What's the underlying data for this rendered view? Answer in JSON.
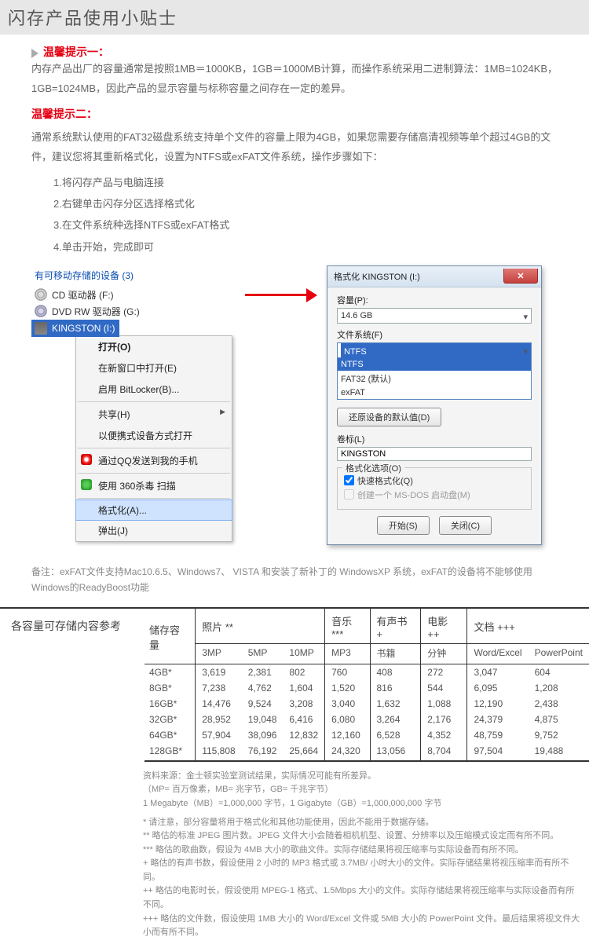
{
  "page": {
    "title": "闪存产品使用小贴士"
  },
  "tip1": {
    "heading": "温馨提示一：",
    "body": "内存产品出厂的容量通常是按照1MB＝1000KB，1GB＝1000MB计算，而操作系统采用二进制算法：1MB=1024KB，1GB=1024MB，因此产品的显示容量与标称容量之间存在一定的差异。"
  },
  "tip2": {
    "heading": "温馨提示二：",
    "body": "通常系统默认使用的FAT32磁盘系统支持单个文件的容量上限为4GB，如果您需要存储高清视频等单个超过4GB的文件，建议您将其重新格式化，设置为NTFS或exFAT文件系统，操作步骤如下：",
    "steps": [
      "1.将闪存产品与电脑连接",
      "2.右键单击闪存分区选择格式化",
      "3.在文件系统种选择NTFS或exFAT格式",
      "4.单击开始，完成即可"
    ]
  },
  "explorer": {
    "heading": "有可移动存储的设备 (3)",
    "cd": "CD 驱动器 (F:)",
    "dvd": "DVD RW 驱动器 (G:)",
    "usb": "KINGSTON (I:)"
  },
  "ctx": {
    "open": "打开(O)",
    "newwin": "在新窗口中打开(E)",
    "bitlocker": "启用 BitLocker(B)...",
    "share": "共享(H)",
    "portable": "以便携式设备方式打开",
    "qq": "通过QQ发送到我的手机",
    "av": "使用 360杀毒 扫描",
    "format": "格式化(A)...",
    "eject": "弹出(J)"
  },
  "dlg": {
    "title": "格式化 KINGSTON (I:)",
    "close": "✕",
    "cap_label": "容量(P):",
    "cap_val": "14.6 GB",
    "fs_label": "文件系统(F)",
    "fs_val": "NTFS",
    "fs_opt1": "NTFS",
    "fs_opt2": "FAT32 (默认)",
    "fs_opt3": "exFAT",
    "restore": "还原设备的默认值(D)",
    "vol_label": "卷标(L)",
    "vol_val": "KINGSTON",
    "opt_legend": "格式化选项(O)",
    "quick": "快速格式化(Q)",
    "msdos": "创建一个 MS-DOS 启动盘(M)",
    "start": "开始(S)",
    "closebtn": "关闭(C)"
  },
  "note": "备注：exFAT文件支持Mac10.6.5、Windows7、 VISTA  和安装了新补丁的 WindowsXP 系统，exFAT的设备将不能够使用Windows的ReadyBoost功能",
  "table": {
    "label": "各容量可存储内容参考",
    "groups": {
      "cap": "储存容量",
      "photo": "照片 **",
      "music": "音乐***",
      "book": "有声书 +",
      "movie": "电影 ++",
      "doc": "文档 +++"
    },
    "subs": {
      "p1": "3MP",
      "p2": "5MP",
      "p3": "10MP",
      "m": "MP3",
      "b": "书籍",
      "mv": "分钟",
      "d1": "Word/Excel",
      "d2": "PowerPoint"
    },
    "rows": [
      {
        "cap": "4GB*",
        "v": [
          "3,619",
          "2,381",
          "802",
          "760",
          "408",
          "272",
          "3,047",
          "604"
        ]
      },
      {
        "cap": "8GB*",
        "v": [
          "7,238",
          "4,762",
          "1,604",
          "1,520",
          "816",
          "544",
          "6,095",
          "1,208"
        ]
      },
      {
        "cap": "16GB*",
        "v": [
          "14,476",
          "9,524",
          "3,208",
          "3,040",
          "1,632",
          "1,088",
          "12,190",
          "2,438"
        ]
      },
      {
        "cap": "32GB*",
        "v": [
          "28,952",
          "19,048",
          "6,416",
          "6,080",
          "3,264",
          "2,176",
          "24,379",
          "4,875"
        ]
      },
      {
        "cap": "64GB*",
        "v": [
          "57,904",
          "38,096",
          "12,832",
          "12,160",
          "6,528",
          "4,352",
          "48,759",
          "9,752"
        ]
      },
      {
        "cap": "128GB*",
        "v": [
          "115,808",
          "76,192",
          "25,664",
          "24,320",
          "13,056",
          "8,704",
          "97,504",
          "19,488"
        ]
      }
    ]
  },
  "fine": {
    "l1": "资料来源：金士顿实验室测试结果，实际情况可能有所差异。",
    "l2": "（MP= 百万像素，MB= 兆字节，GB= 千兆字节）",
    "l3": "1 Megabyte（MB）=1,000,000 字节，1 Gigabyte（GB）=1,000,000,000 字节",
    "l4": "* 请注意，部分容量将用于格式化和其他功能使用，因此不能用于数据存储。",
    "l5": "** 略估的标准 JPEG 图片数。JPEG 文件大小会随着相机机型、设置、分辨率以及压缩模式设定而有所不同。",
    "l6": "*** 略估的歌曲数，假设为 4MB 大小的歌曲文件。实际存储结果将视压缩率与实际设备而有所不同。",
    "l7": "+ 略估的有声书数，假设使用 2 小时的 MP3 格式或 3.7MB/ 小时大小的文件。实际存储结果将视压缩率而有所不同。",
    "l8": "++ 略估的电影时长，假设使用 MPEG-1 格式、1.5Mbps 大小的文件。实际存储结果将视压缩率与实际设备而有所不同。",
    "l9": "+++ 略估的文件数，假设使用 1MB 大小的 Word/Excel 文件或 5MB 大小的 PowerPoint 文件。最后结果将视文件大小而有所不同。"
  }
}
